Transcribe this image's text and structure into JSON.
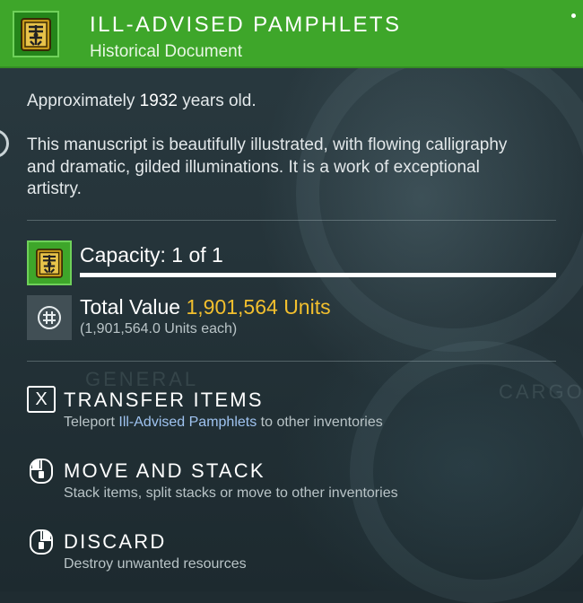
{
  "item": {
    "name": "ILL-ADVISED PAMPHLETS",
    "category": "Historical Document",
    "icon": "golden-book-icon",
    "header_color": "#3ea62a"
  },
  "age": {
    "prefix": "Approximately",
    "years": "1932",
    "suffix": "years old."
  },
  "description": "This manuscript is beautifully illustrated, with flowing calligraphy and dramatic, gilded illuminations. It is a work of exceptional artistry.",
  "capacity": {
    "label": "Capacity: 1 of 1",
    "fill_fraction": 1.0
  },
  "value": {
    "label": "Total Value",
    "amount": "1,901,564 Units",
    "each": "(1,901,564.0 Units each)",
    "amount_color": "#f2bf2e",
    "icon": "units-currency-icon"
  },
  "background_words": {
    "left": "GENERAL",
    "right": "CARGO"
  },
  "actions": [
    {
      "key": "X",
      "title": "TRANSFER ITEMS",
      "desc_before": "Teleport ",
      "desc_highlight": "Ill-Advised Pamphlets",
      "desc_after": " to other inventories",
      "icon": "x-key-icon"
    },
    {
      "title": "MOVE AND STACK",
      "desc": "Stack items, split stacks or move to other inventories",
      "icon": "mouse-left-click-icon"
    },
    {
      "title": "DISCARD",
      "desc": "Destroy unwanted resources",
      "icon": "mouse-right-click-icon"
    }
  ]
}
